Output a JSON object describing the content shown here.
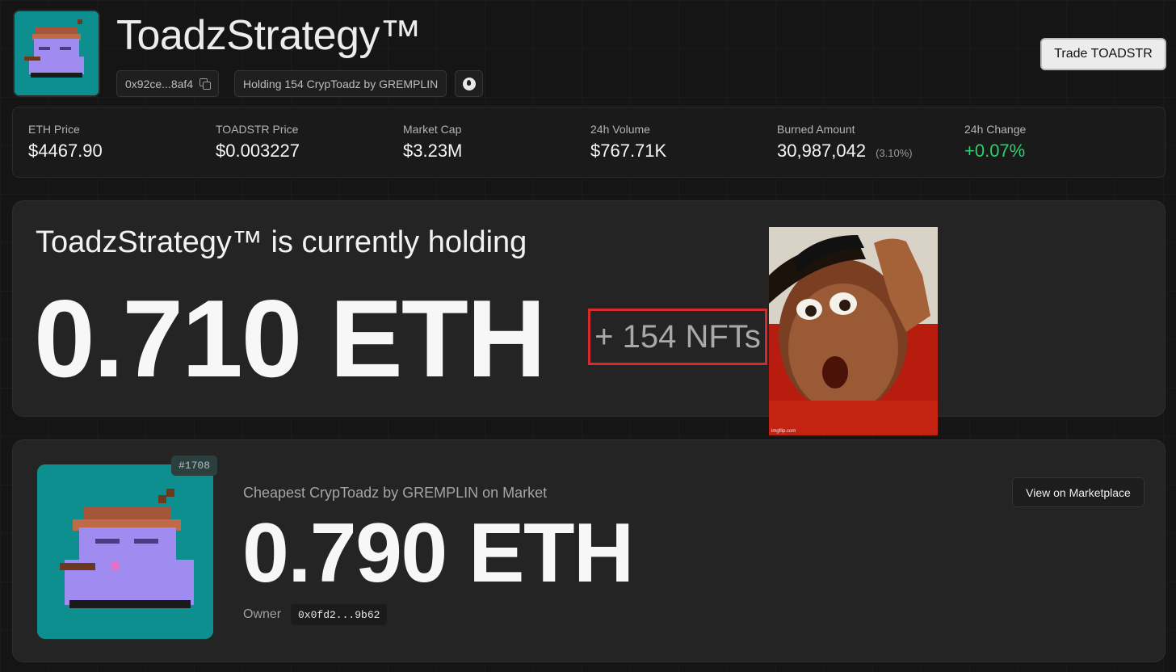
{
  "header": {
    "title": "ToadzStrategy™",
    "contract_address": "0x92ce...8af4",
    "holding_text": "Holding 154 CrypToadz by GREMPLIN",
    "trade_button": "Trade TOADSTR",
    "icons": [
      "toad-logo-icon",
      "copy-icon",
      "opensea-icon"
    ]
  },
  "stats": {
    "eth_price_label": "ETH Price",
    "eth_price": "$4467.90",
    "toadstr_price_label": "TOADSTR Price",
    "toadstr_price": "$0.003227",
    "market_cap_label": "Market Cap",
    "market_cap": "$3.23M",
    "volume_label": "24h Volume",
    "volume": "$767.71K",
    "burned_label": "Burned Amount",
    "burned": "30,987,042",
    "burned_pct": "(3.10%)",
    "change_label": "24h Change",
    "change": "+0.07%"
  },
  "holding": {
    "title": "ToadzStrategy™ is currently holding",
    "eth_amount": "0.710 ETH",
    "nfts": "+ 154 NFTs",
    "meme_caption": "imgflip.com"
  },
  "cheapest": {
    "token_id": "#1708",
    "label": "Cheapest CrypToadz by GREMPLIN on Market",
    "price": "0.790 ETH",
    "owner_label": "Owner",
    "owner_address": "0x0fd2...9b62",
    "marketplace_button": "View on Marketplace"
  },
  "colors": {
    "background": "#151515",
    "card": "#242424",
    "positive": "#2bd06a",
    "highlight_border": "#d9292b",
    "toad_bg": "#0e8f8f",
    "toad_body": "#a08cf0"
  }
}
